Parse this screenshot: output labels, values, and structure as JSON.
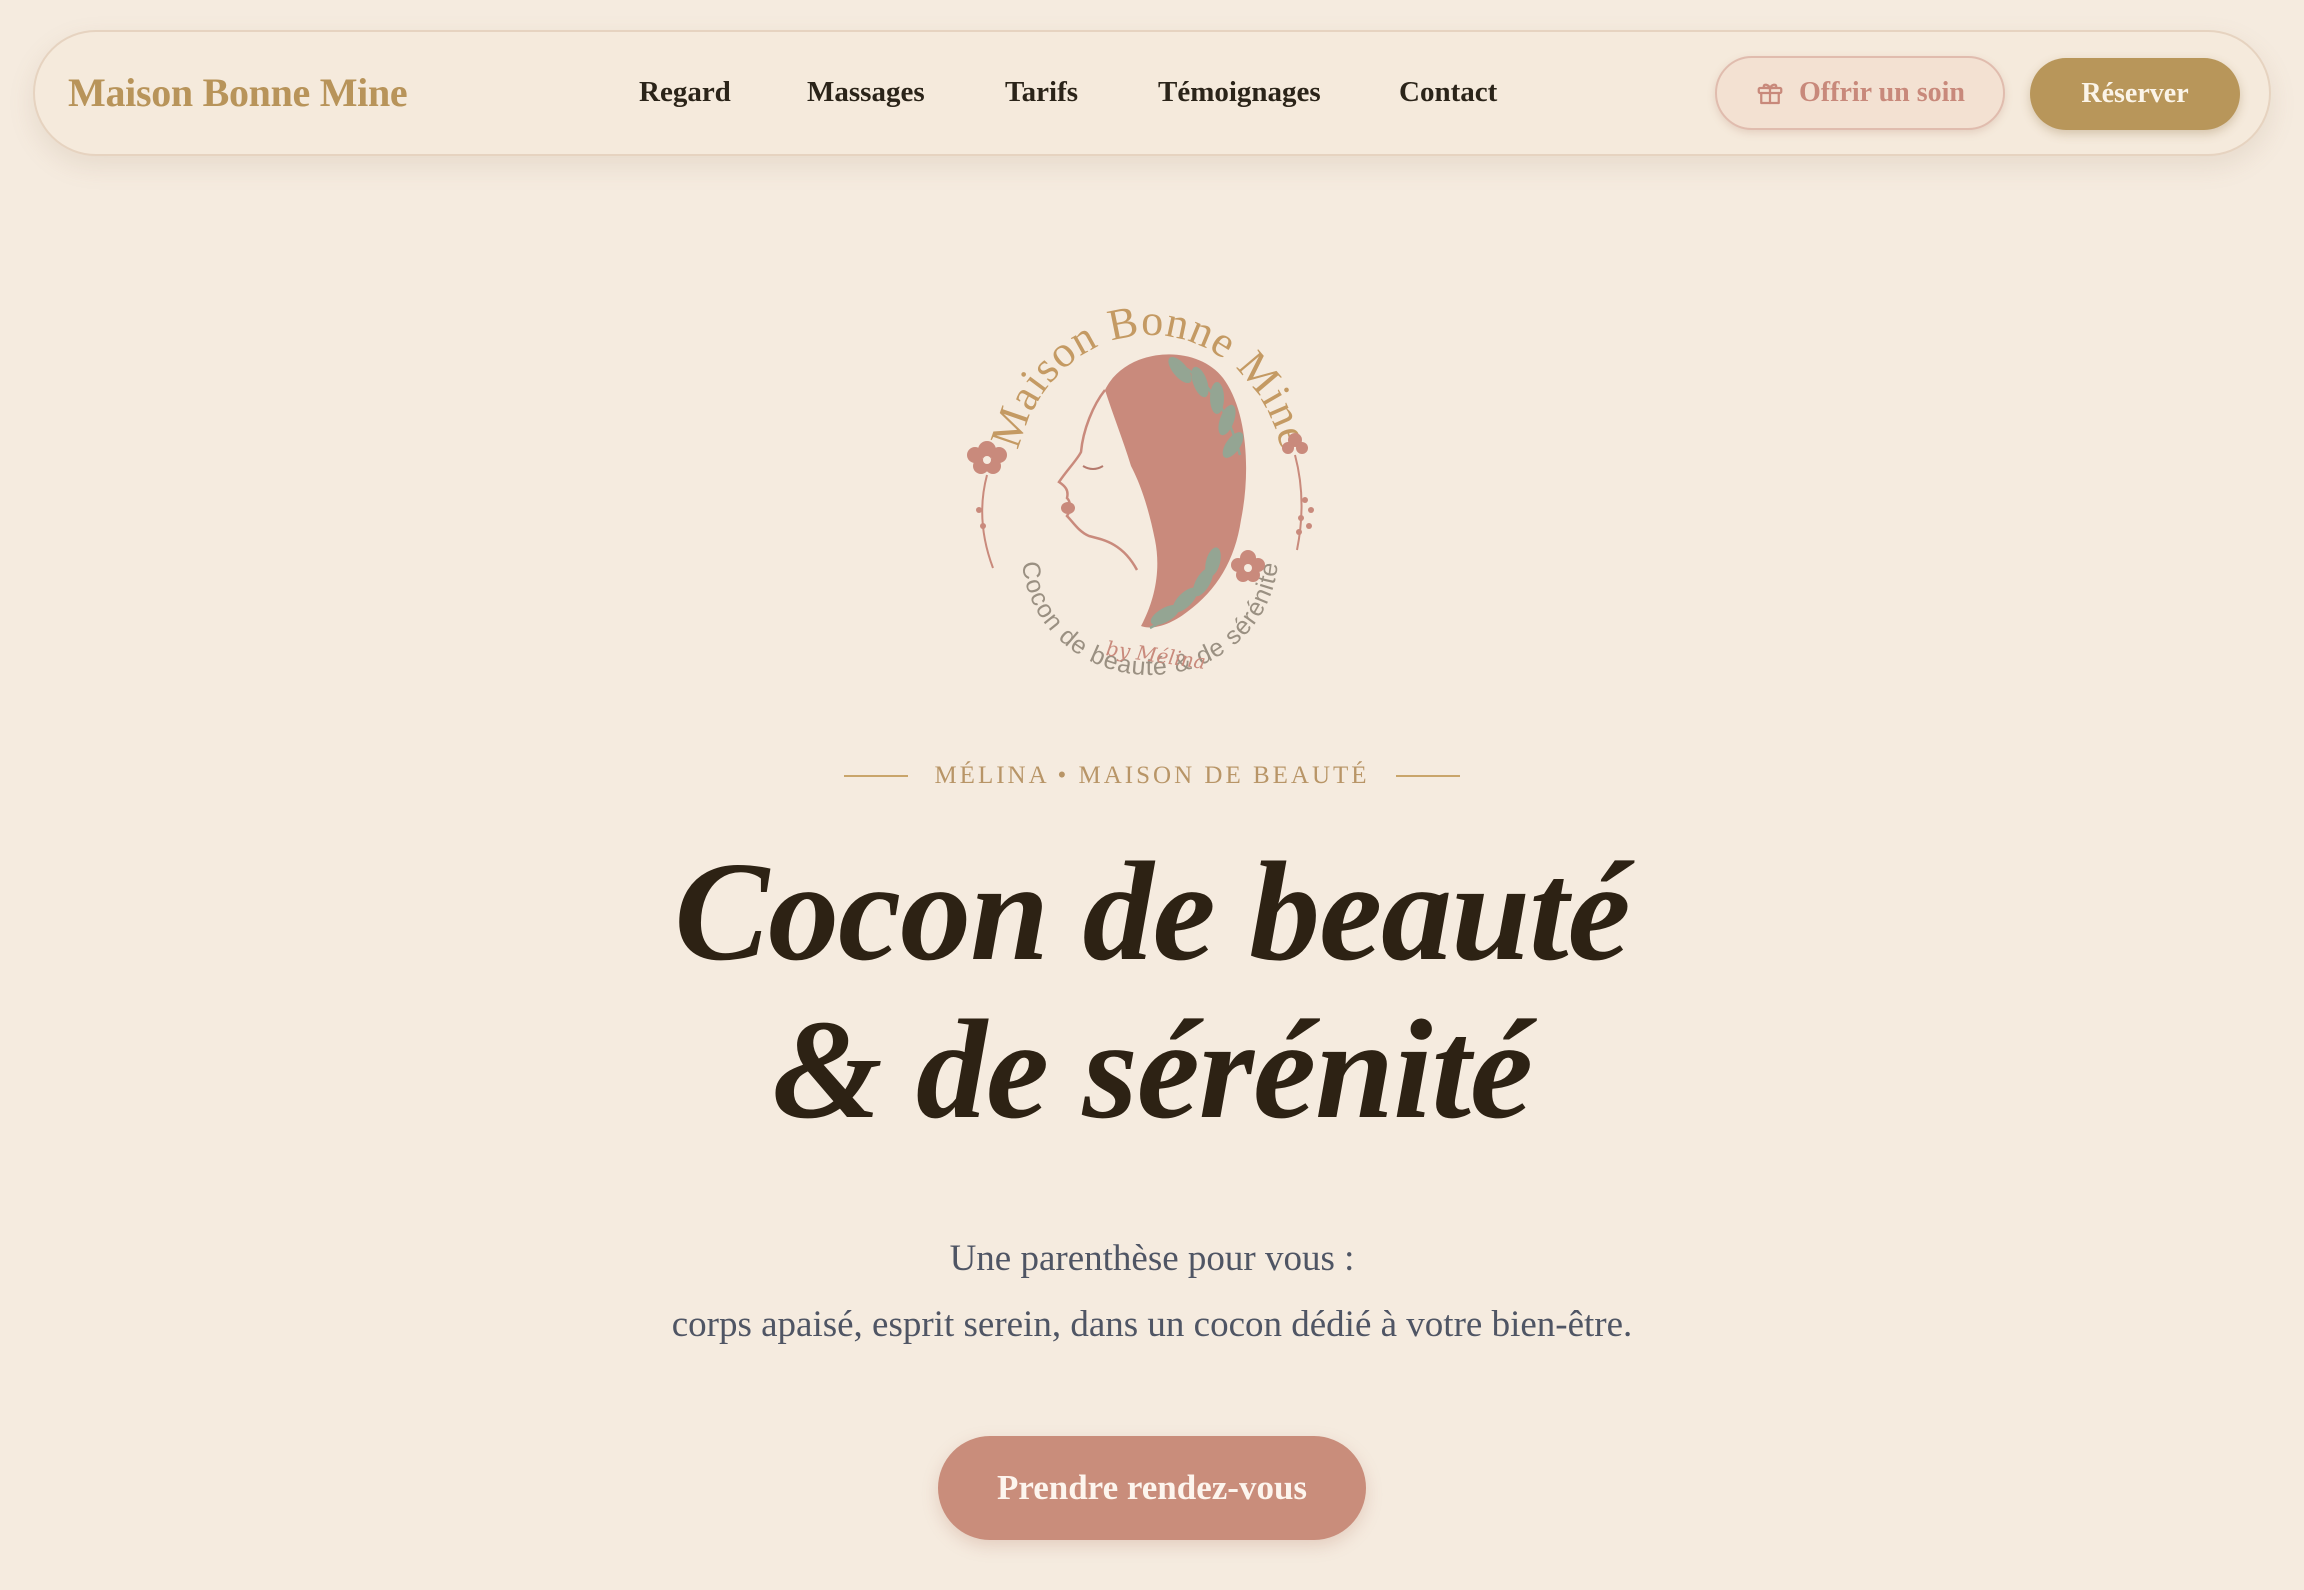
{
  "brand": {
    "name": "Maison Bonne Mine"
  },
  "nav": {
    "links": [
      "Regard",
      "Massages",
      "Tarifs",
      "Témoignages",
      "Contact"
    ],
    "gift_button": "Offrir un soin",
    "gift_icon": "gift-icon",
    "book_button": "Réserver"
  },
  "logo": {
    "top_text": "Maison Bonne Mine",
    "signature": "by Mélina",
    "bottom_text": "Cocon de beauté & de sérénité"
  },
  "hero": {
    "eyebrow": "MÉLINA • MAISON DE BEAUTÉ",
    "title_line1": "Cocon de beauté",
    "title_line2": "& de sérénité",
    "subtitle_line1": "Une parenthèse pour vous :",
    "subtitle_line2": "corps apaisé, esprit serein, dans un cocon dédié à votre bien-être.",
    "cta": "Prendre rendez-vous"
  },
  "colors": {
    "background": "#f5ebdf",
    "gold": "#b8965a",
    "rose": "#c98d7b",
    "sage": "#94a593",
    "title": "#2d2214",
    "body_text": "#4f5564"
  }
}
